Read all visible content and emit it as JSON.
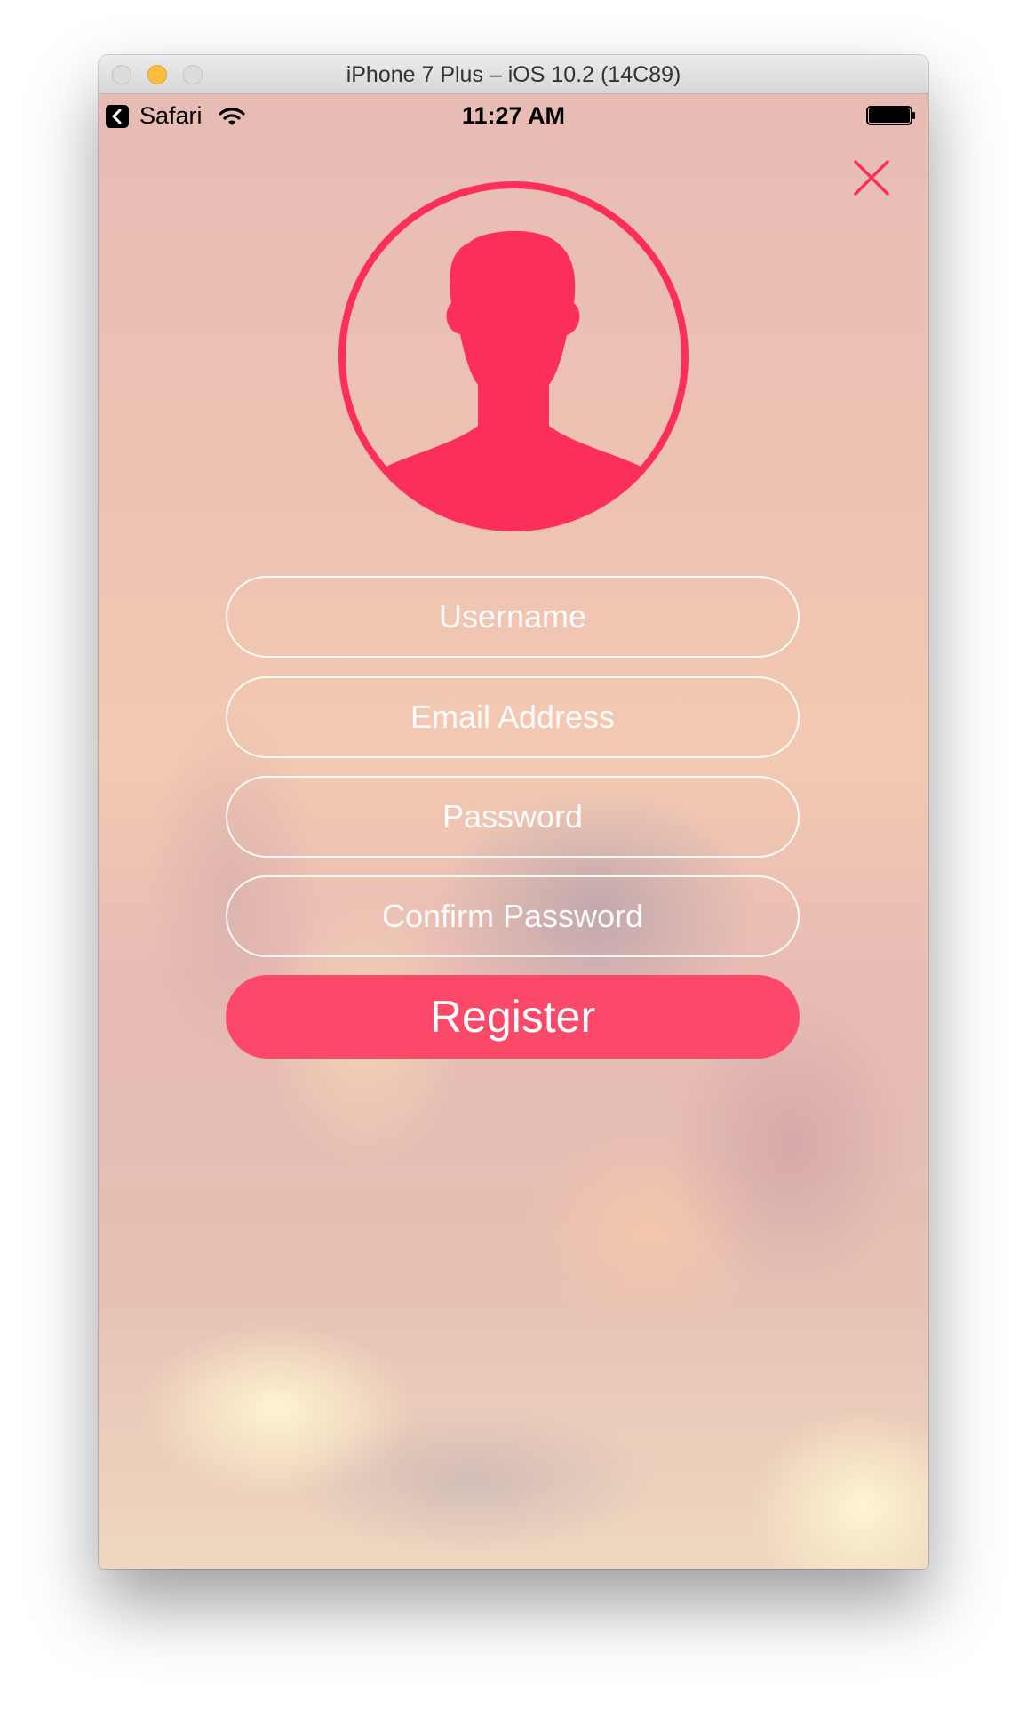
{
  "window": {
    "title": "iPhone 7 Plus – iOS 10.2 (14C89)"
  },
  "status_bar": {
    "back_app": "Safari",
    "time": "11:27 AM"
  },
  "form": {
    "username_placeholder": "Username",
    "email_placeholder": "Email Address",
    "password_placeholder": "Password",
    "confirm_password_placeholder": "Confirm Password",
    "register_label": "Register"
  },
  "icons": {
    "close": "close-icon",
    "avatar": "user-avatar-icon",
    "wifi": "wifi-icon",
    "battery": "battery-icon",
    "back": "back-chevron-icon"
  },
  "colors": {
    "accent": "#fc4869",
    "icon_pink": "#fb2f5a",
    "field_border": "#ffffff"
  },
  "battery": {
    "level": 1.0
  }
}
